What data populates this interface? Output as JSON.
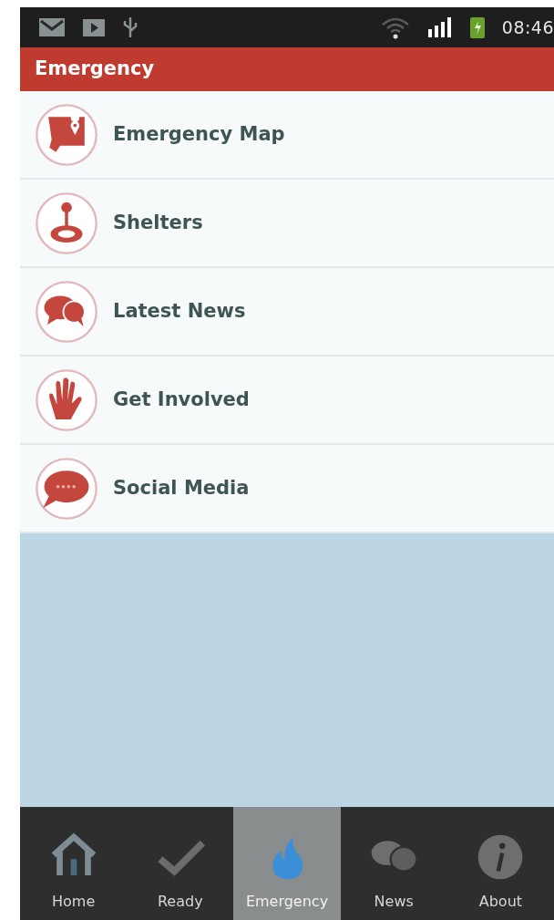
{
  "status_bar": {
    "time": "08:46"
  },
  "title_bar": {
    "title": "Emergency"
  },
  "menu": [
    {
      "label": "Emergency Map",
      "kind": "map"
    },
    {
      "label": "Shelters",
      "kind": "pin"
    },
    {
      "label": "Latest News",
      "kind": "chat"
    },
    {
      "label": "Get Involved",
      "kind": "hand"
    },
    {
      "label": "Social Media",
      "kind": "speech"
    }
  ],
  "tabs": [
    {
      "label": "Home",
      "kind": "home",
      "selected": false
    },
    {
      "label": "Ready",
      "kind": "check",
      "selected": false
    },
    {
      "label": "Emergency",
      "kind": "flame",
      "selected": true
    },
    {
      "label": "News",
      "kind": "chat",
      "selected": false
    },
    {
      "label": "About",
      "kind": "info",
      "selected": false
    }
  ]
}
